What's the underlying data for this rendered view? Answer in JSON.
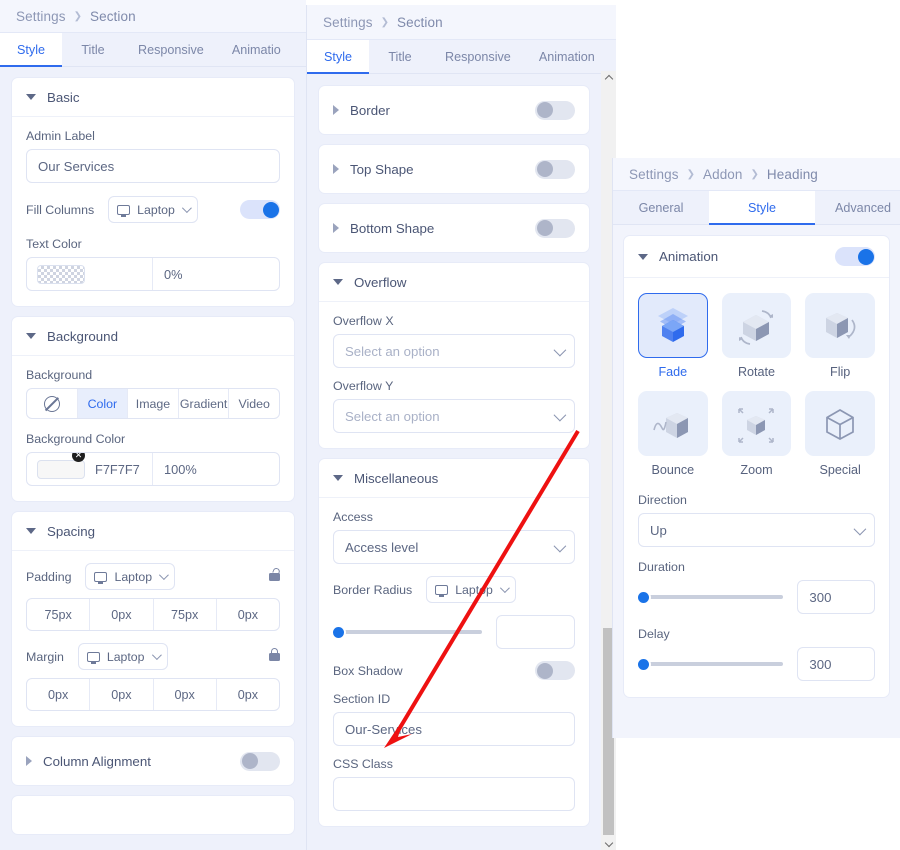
{
  "left_panel": {
    "breadcrumb": [
      "Settings",
      "Section"
    ],
    "tabs": [
      {
        "label": "Style",
        "active": true
      },
      {
        "label": "Title",
        "active": false
      },
      {
        "label": "Responsive",
        "active": false
      },
      {
        "label": "Animatio",
        "active": false
      }
    ],
    "basic": {
      "title": "Basic",
      "admin_label_label": "Admin Label",
      "admin_label_value": "Our Services",
      "fill_columns_label": "Fill Columns",
      "fill_columns_device": "Laptop",
      "fill_columns_toggle": "on",
      "text_color_label": "Text Color",
      "text_color_hex": "",
      "text_color_opacity": "0%"
    },
    "background": {
      "title": "Background",
      "type_label": "Background",
      "types": [
        "none-icon",
        "Color",
        "Image",
        "Gradient",
        "Video"
      ],
      "active_type": "Color",
      "color_label": "Background Color",
      "color_hex": "F7F7F7",
      "color_opacity": "100%"
    },
    "spacing": {
      "title": "Spacing",
      "padding_label": "Padding",
      "padding_device": "Laptop",
      "padding_values": [
        "75px",
        "0px",
        "75px",
        "0px"
      ],
      "padding_lock": "unlocked",
      "margin_label": "Margin",
      "margin_device": "Laptop",
      "margin_values": [
        "0px",
        "0px",
        "0px",
        "0px"
      ],
      "margin_lock": "locked"
    },
    "column_alignment": {
      "title": "Column Alignment",
      "toggle": "off"
    }
  },
  "mid_panel": {
    "breadcrumb": [
      "Settings",
      "Section"
    ],
    "tabs": [
      {
        "label": "Style",
        "active": true
      },
      {
        "label": "Title",
        "active": false
      },
      {
        "label": "Responsive",
        "active": false
      },
      {
        "label": "Animation",
        "active": false
      }
    ],
    "border": {
      "title": "Border",
      "toggle": "off"
    },
    "top_shape": {
      "title": "Top Shape",
      "toggle": "off"
    },
    "bottom_shape": {
      "title": "Bottom Shape",
      "toggle": "off"
    },
    "overflow": {
      "title": "Overflow",
      "x_label": "Overflow X",
      "x_placeholder": "Select an option",
      "y_label": "Overflow Y",
      "y_placeholder": "Select an option"
    },
    "miscellaneous": {
      "title": "Miscellaneous",
      "access_label": "Access",
      "access_value": "Access level",
      "border_radius_label": "Border Radius",
      "border_radius_device": "Laptop",
      "border_radius_value": "",
      "box_shadow_label": "Box Shadow",
      "box_shadow_toggle": "off",
      "section_id_label": "Section ID",
      "section_id_value": "Our-Services",
      "css_class_label": "CSS Class",
      "css_class_value": ""
    },
    "scrollbar": {
      "position": "near-bottom"
    }
  },
  "right_panel": {
    "breadcrumb": [
      "Settings",
      "Addon",
      "Heading"
    ],
    "tabs": [
      {
        "label": "General",
        "active": false
      },
      {
        "label": "Style",
        "active": true
      },
      {
        "label": "Advanced",
        "active": false
      }
    ],
    "animation": {
      "title": "Animation",
      "toggle": "on",
      "options": [
        {
          "label": "Fade",
          "icon": "cube-fade-icon",
          "selected": true
        },
        {
          "label": "Rotate",
          "icon": "cube-rotate-icon",
          "selected": false
        },
        {
          "label": "Flip",
          "icon": "cube-flip-icon",
          "selected": false
        },
        {
          "label": "Bounce",
          "icon": "cube-bounce-icon",
          "selected": false
        },
        {
          "label": "Zoom",
          "icon": "cube-zoom-icon",
          "selected": false
        },
        {
          "label": "Special",
          "icon": "cube-outline-icon",
          "selected": false
        }
      ],
      "direction_label": "Direction",
      "direction_value": "Up",
      "duration_label": "Duration",
      "duration_value": "300",
      "delay_label": "Delay",
      "delay_value": "300"
    }
  },
  "annotation": {
    "type": "red-arrow",
    "from": [
      578,
      430
    ],
    "to": [
      388,
      742
    ],
    "color": "#ee1111"
  }
}
